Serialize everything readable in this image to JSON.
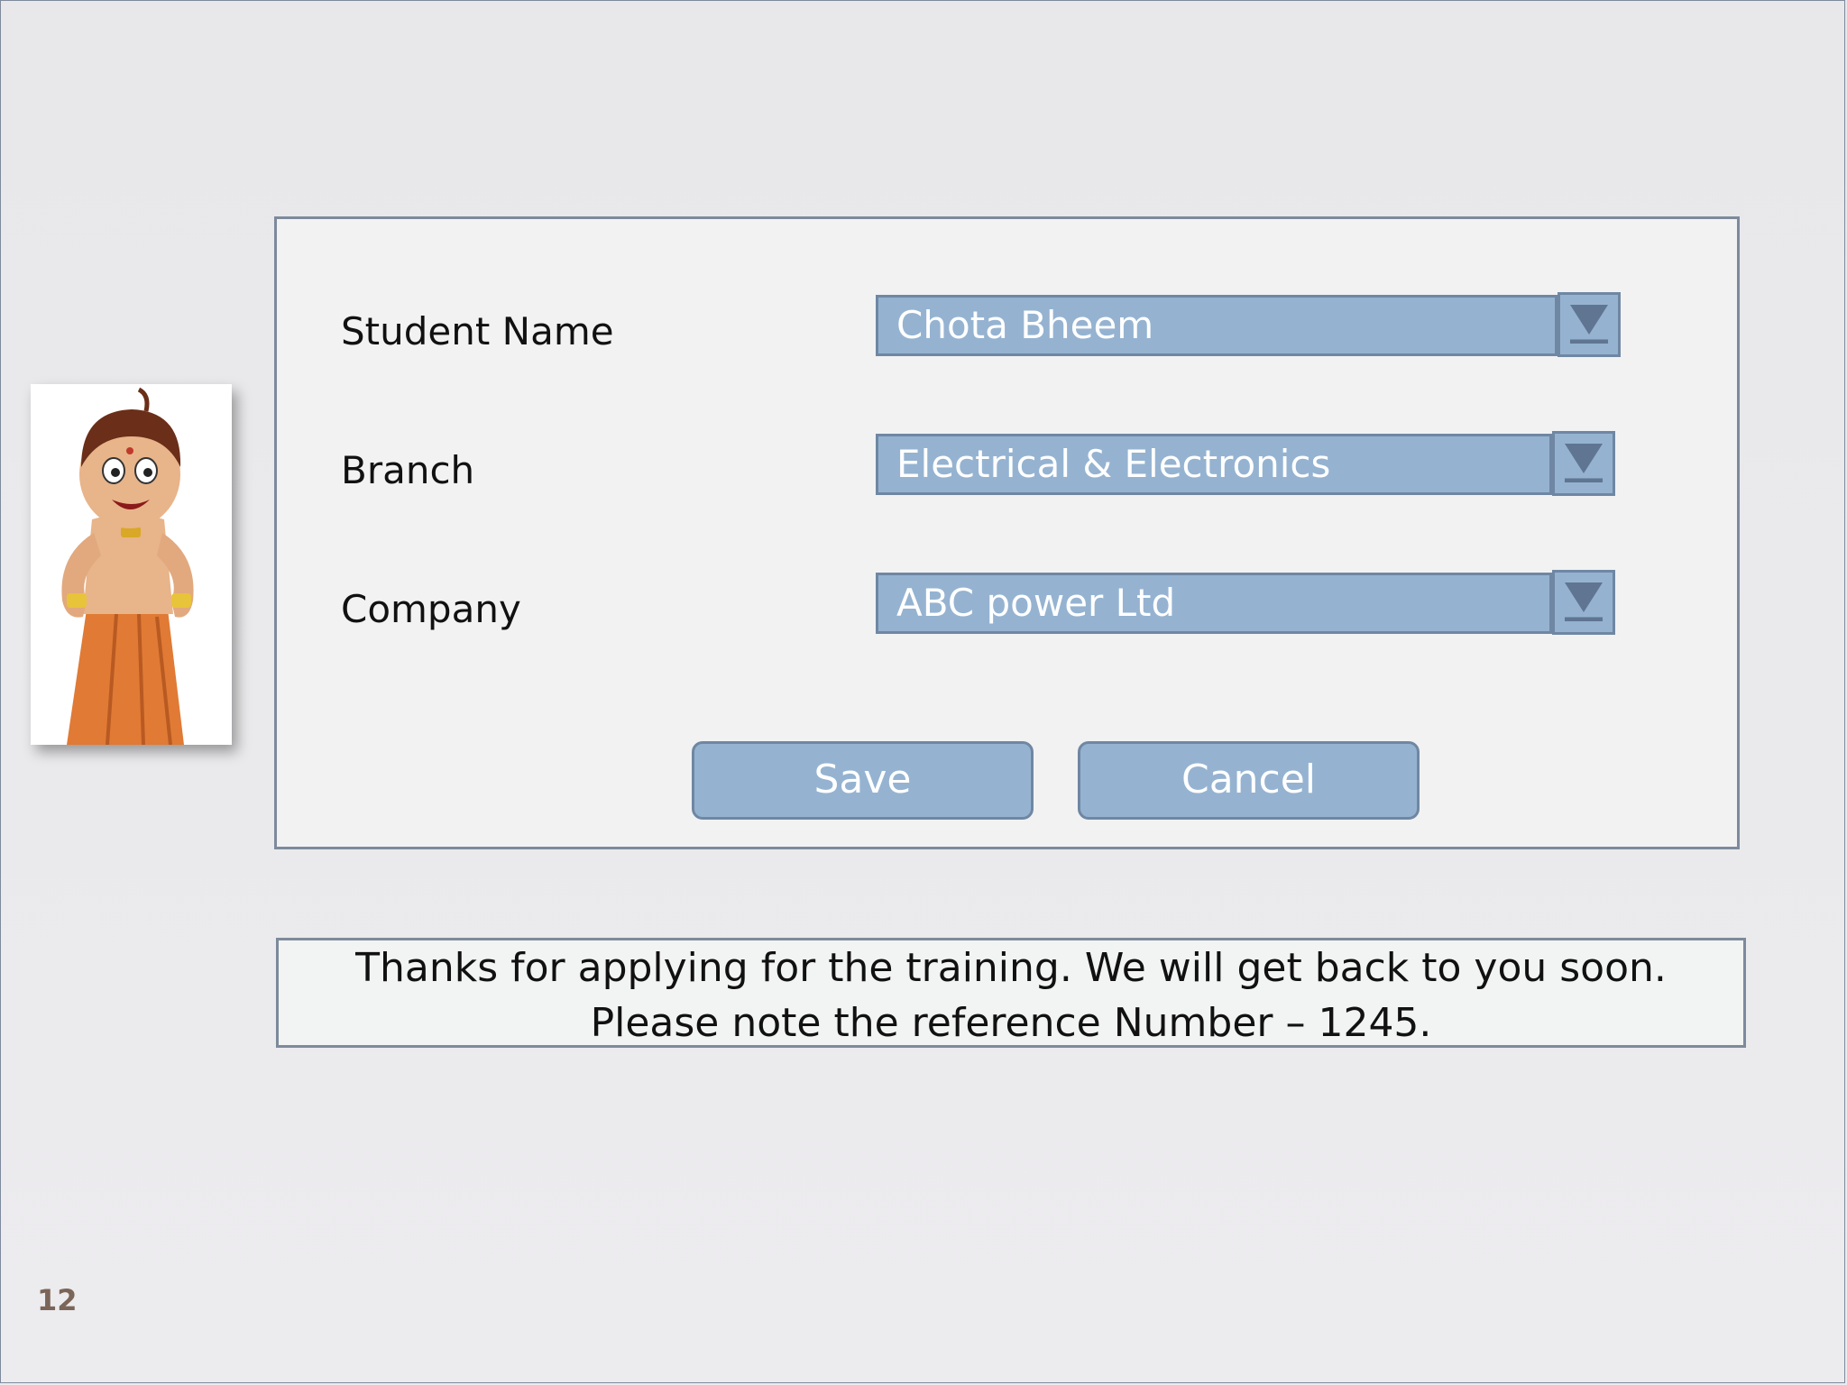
{
  "form": {
    "student_name_label": "Student Name",
    "student_name_value": "Chota Bheem",
    "branch_label": "Branch",
    "branch_value": "Electrical & Electronics",
    "company_label": "Company",
    "company_value": "ABC power Ltd",
    "save_label": "Save",
    "cancel_label": "Cancel"
  },
  "message": "Thanks for applying for the training. We will get back to you soon. Please note the reference Number – 1245.",
  "page_number": "12",
  "colors": {
    "field_fill": "#95b3d1",
    "field_border": "#6f87a3",
    "panel_border": "#7d8a9c",
    "page_number": "#7a6558"
  },
  "icons": {
    "avatar": "cartoon-boy-character",
    "dropdown": "dropdown-arrow-icon"
  }
}
